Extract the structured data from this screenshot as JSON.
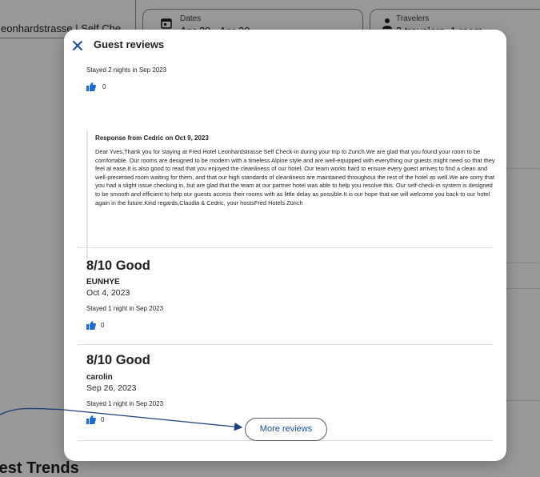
{
  "background": {
    "destination_value": "eonhardstrasse | Self Che",
    "dates": {
      "label": "Dates",
      "value": "Apr 29 - Apr 30"
    },
    "travelers": {
      "label": "Travelers",
      "value": "2 travelers, 1 room"
    },
    "section_heading": "test Trends"
  },
  "modal": {
    "title": "Guest reviews",
    "first_review": {
      "stay": "Stayed 2 nights in Sep 2023",
      "helpful_count": "0",
      "response": {
        "title": "Response from Cedric on Oct 9, 2023",
        "text": "Dear Yves,Thank you for staying at Fred Hotel Leonhardstrasse Self Check-in during your trip to Zurich.We are glad that you found your room to be comfortable. Our rooms are designed to be modern with a timeless Alpine style and are well-equipped with everything our guests might need so that they feel at ease.It is also good to read that you enjoyed the cleanliness of our hotel. Our team works hard to ensure every guest arrives to find a clean and well-presented room waiting for them, and that our high standards of cleanliness are maintained throughout the rest of the hotel as well.We are sorry that you had a slight issue checking in, but are glad that the team at our partner hotel was able to help you resolve this. Our self-check-in system is designed to be smooth and efficient to help our guests access their rooms with as little delay as possible.It is our hope that we will welcome you back to our hotel again in the future.Kind regards,Claudia & Cedric, your hostsFred Hotels Zürich"
      }
    },
    "reviews": [
      {
        "rating": "8/10 Good",
        "author": "EUNHYE",
        "date": "Oct 4, 2023",
        "stay": "Stayed 1 night in Sep 2023",
        "helpful_count": "0"
      },
      {
        "rating": "8/10 Good",
        "author": "carolin",
        "date": "Sep 26, 2023",
        "stay": "Stayed 1 night in Sep 2023",
        "helpful_count": "0"
      }
    ],
    "more_button": "More reviews"
  },
  "colors": {
    "accent": "#1b4ea3",
    "thumb": "#1f6bd6",
    "arrow": "#1b3f7a"
  }
}
